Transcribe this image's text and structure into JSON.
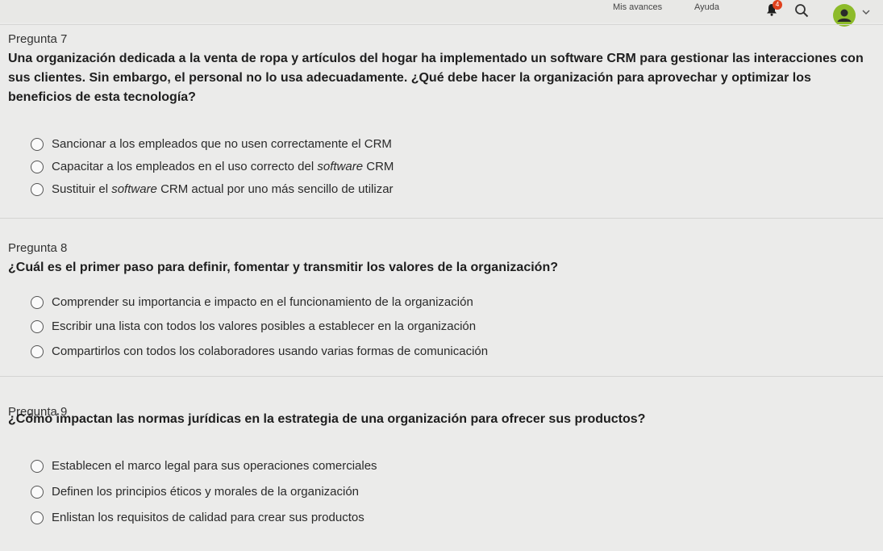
{
  "header": {
    "nav_progress": "Mis avances",
    "nav_help": "Ayuda",
    "notification_count": "4",
    "icons": [
      "bell-icon",
      "search-icon",
      "user-avatar-icon",
      "chevron-down-icon"
    ],
    "accent_color": "#8dbb2a",
    "badge_color": "#e0411d"
  },
  "questions": [
    {
      "number": "Pregunta 7",
      "text": "Una organización dedicada a la venta de ropa y artículos del hogar ha implementado un software CRM para gestionar las interacciones con sus clientes. Sin embargo, el personal no lo usa adecuadamente. ¿Qué debe hacer la organización para aprovechar y optimizar los beneficios de esta tecnología?",
      "options": [
        "Sancionar a los empleados que no usen correctamente el CRM",
        "Capacitar a los empleados en el uso correcto del software CRM",
        "Sustituir el software CRM actual por uno más sencillo de utilizar"
      ]
    },
    {
      "number": "Pregunta 8",
      "text": "¿Cuál es el primer paso para definir, fomentar y transmitir los valores de la organización?",
      "options": [
        "Comprender su importancia e impacto en el funcionamiento de la organización",
        "Escribir una lista con todos los valores posibles a establecer en la organización",
        "Compartirlos con todos los colaboradores usando varias formas de comunicación"
      ]
    },
    {
      "number": "Pregunta 9",
      "text": "¿Cómo impactan las normas jurídicas en la estrategia de una organización para ofrecer sus productos?",
      "options": [
        "Establecen el marco legal para sus operaciones comerciales",
        "Definen los principios éticos y morales de la organización",
        "Enlistan los requisitos de calidad para crear sus productos"
      ]
    }
  ]
}
